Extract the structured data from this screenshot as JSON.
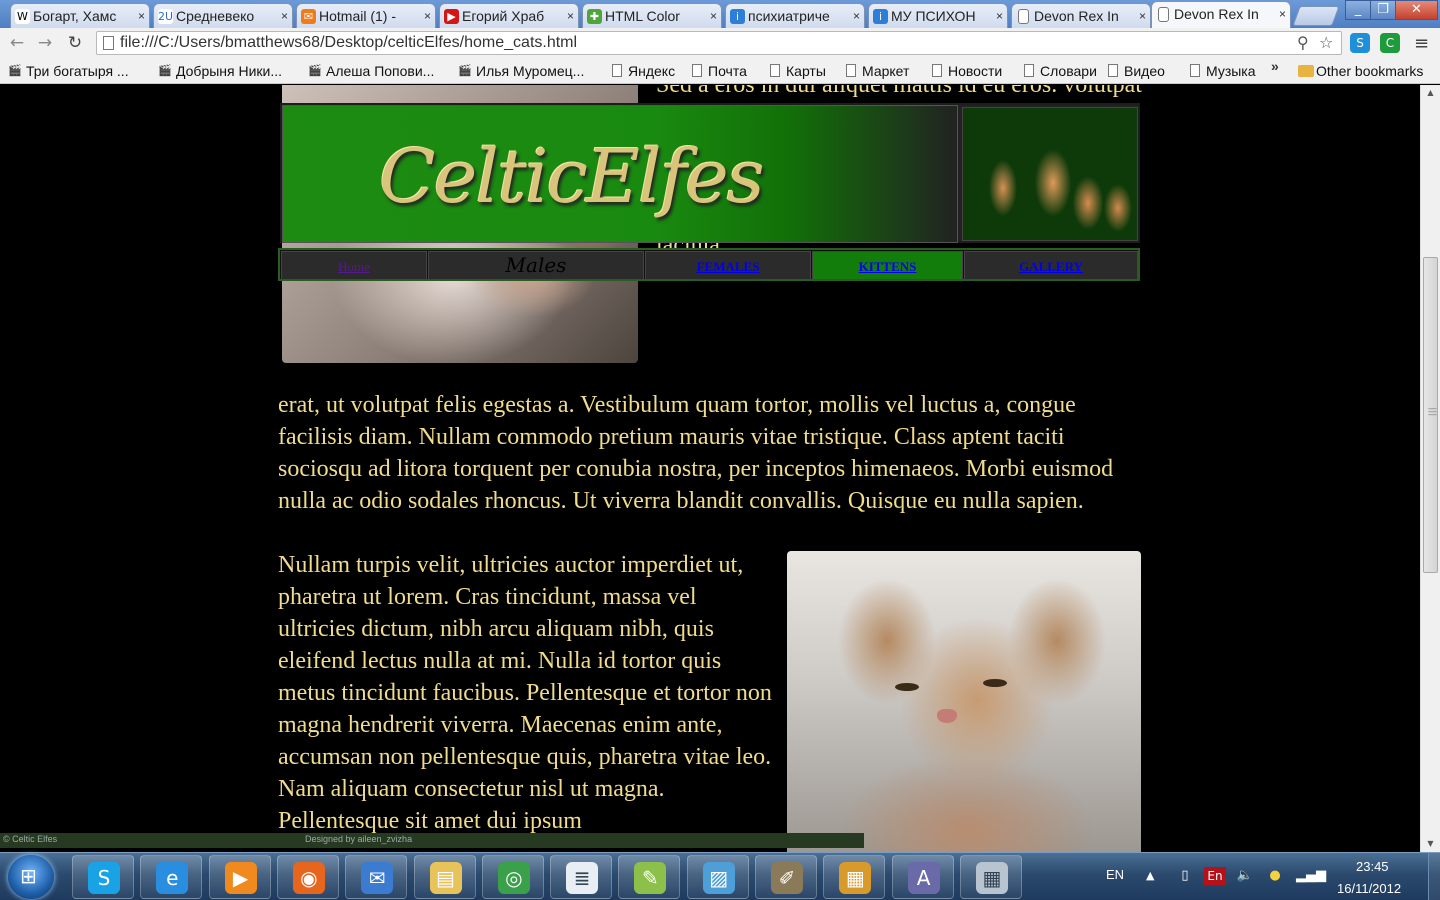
{
  "browser": {
    "tabs": [
      {
        "title": "Богарт, Хамс",
        "icon": "wikipedia-icon",
        "glyph": "W",
        "bg": "#ffffff",
        "fg": "#000000"
      },
      {
        "title": "Средневеко",
        "icon": "liveinternet-icon",
        "glyph": "2U",
        "bg": "#ffffff",
        "fg": "#2a6fc9"
      },
      {
        "title": "Hotmail (1) -",
        "icon": "hotmail-icon",
        "glyph": "✉",
        "bg": "#f07b18",
        "fg": "#ffffff"
      },
      {
        "title": "Егорий Храб",
        "icon": "youtube-icon",
        "glyph": "▶",
        "bg": "#d51616",
        "fg": "#ffffff"
      },
      {
        "title": "HTML Color",
        "icon": "colorpicker-icon",
        "glyph": "✚",
        "bg": "#4ea63a",
        "fg": "#ffffff"
      },
      {
        "title": "психиатриче",
        "icon": "info-icon",
        "glyph": "i",
        "bg": "#2c7ed6",
        "fg": "#ffffff"
      },
      {
        "title": "МУ ПСИХОН",
        "icon": "info-icon",
        "glyph": "i",
        "bg": "#2c7ed6",
        "fg": "#ffffff"
      },
      {
        "title": "Devon Rex In",
        "icon": "page-icon",
        "glyph": "",
        "bg": "#ffffff",
        "fg": "#555555"
      },
      {
        "title": "Devon Rex In",
        "icon": "page-icon",
        "glyph": "",
        "bg": "#ffffff",
        "fg": "#555555",
        "active": true
      }
    ],
    "url": "file:///C:/Users/bmatthews68/Desktop/celticElfes/home_cats.html",
    "bookmarks": [
      {
        "label": "Три богатыря ...",
        "icon": "clapper-icon"
      },
      {
        "label": "Добрыня Ники...",
        "icon": "clapper-icon"
      },
      {
        "label": "Алеша Попови...",
        "icon": "clapper-icon"
      },
      {
        "label": "Илья Муромец...",
        "icon": "clapper-icon"
      },
      {
        "label": "Яндекс",
        "icon": "page-icon"
      },
      {
        "label": "Почта",
        "icon": "page-icon"
      },
      {
        "label": "Карты",
        "icon": "page-icon"
      },
      {
        "label": "Маркет",
        "icon": "page-icon"
      },
      {
        "label": "Новости",
        "icon": "page-icon"
      },
      {
        "label": "Словари",
        "icon": "page-icon"
      },
      {
        "label": "Видео",
        "icon": "page-icon"
      },
      {
        "label": "Музыка",
        "icon": "page-icon"
      }
    ],
    "bookmarks_more": "»",
    "other_bookmarks": "Other bookmarks"
  },
  "page": {
    "logo": "CelticElfes",
    "nav": [
      {
        "label": "Home",
        "kind": "home"
      },
      {
        "label": "Males",
        "kind": "current"
      },
      {
        "label": "FEMALES",
        "kind": "link"
      },
      {
        "label": "KITTENS",
        "kind": "green"
      },
      {
        "label": "GALLERY",
        "kind": "link"
      }
    ],
    "text_top": "Sed a eros in dui aliquet mattis id eu eros. volutpat dapibus mauris, vel dignissim commodo eget. Suspendisse vehicula malesuada felis ut lobortis. Nulla facilisi. In in nulla nisi. Etiam tristique scelerisque sollicitudin. Vestibulum aliquam lacinia",
    "text_mid": "erat, ut volutpat felis egestas a. Vestibulum quam tortor, mollis vel luctus a, congue facilisis diam. Nullam commodo pretium mauris vitae tristique. Class aptent taciti sociosqu ad litora torquent per conubia nostra, per inceptos himenaeos. Morbi euismod nulla ac odio sodales rhoncus. Ut viverra blandit convallis. Quisque eu nulla sapien.",
    "text_bottom": "Nullam turpis velit, ultricies auctor imperdiet ut, pharetra ut lorem. Cras tincidunt, massa vel ultricies dictum, nibh arcu aliquam nibh, quis eleifend lectus nulla at mi. Nulla id tortor quis metus tincidunt faucibus. Pellentesque et tortor non magna hendrerit viverra. Maecenas enim ante, accumsan non pellentesque quis, pharetra vitae leo. Nam aliquam consectetur nisl ut magna. Pellentesque sit amet dui ipsum",
    "footer_left": "© Celtic Elfes",
    "footer_right": "Designed by aileen_zvizha",
    "text_color": "#f0dc8c"
  },
  "taskbar": {
    "apps": [
      "skype-icon",
      "internet-explorer-icon",
      "media-player-icon",
      "firefox-icon",
      "mail-icon",
      "explorer-folder-icon",
      "chrome-icon",
      "notepad-icon",
      "notepad-frog-icon",
      "picture-viewer-icon",
      "gimp-icon",
      "file-manager-icon",
      "font-editor-icon",
      "calculator-icon"
    ],
    "lang": "EN",
    "lang_badge": "En",
    "time": "23:45",
    "date": "16/11/2012"
  }
}
